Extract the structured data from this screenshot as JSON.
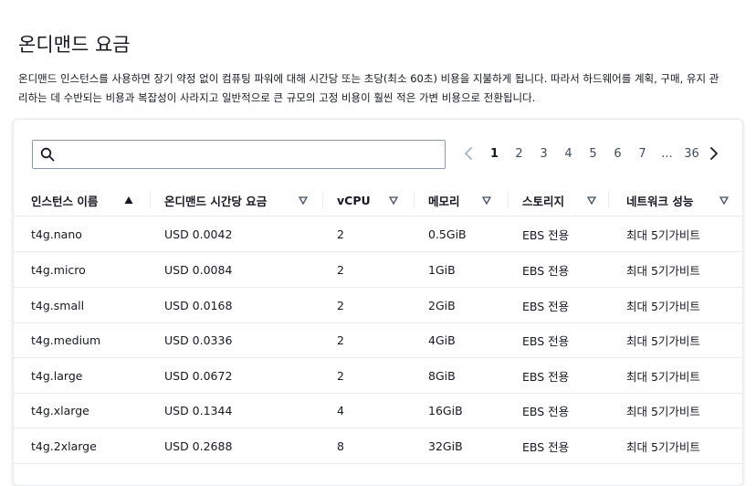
{
  "page": {
    "title": "온디맨드 요금",
    "description_line1": "온디맨드 인스턴스를 사용하면 장기 약정 없이 컴퓨팅 파워에 대해 시간당 또는 초당(최소 60초) 비용을 지불하게 됩니다. 따라서 하드웨어를 계획, 구매, 유지 관",
    "description_line2": "리하는 데 수반되는 비용과 복잡성이 사라지고 일반적으로 큰 규모의 고정 비용이 훨씬 적은 가변 비용으로 전환됩니다."
  },
  "search": {
    "value": "",
    "placeholder": ""
  },
  "pagination": {
    "pages": [
      "1",
      "2",
      "3",
      "4",
      "5",
      "6",
      "7"
    ],
    "current": "1",
    "ellipsis": "...",
    "last": "36",
    "prev_icon": "chevron-left-icon",
    "next_icon": "chevron-right-icon"
  },
  "table": {
    "columns": [
      {
        "label": "인스턴스 이름",
        "sort": "ascending"
      },
      {
        "label": "온디맨드 시간당 요금",
        "sort": "none"
      },
      {
        "label": "vCPU",
        "sort": "none"
      },
      {
        "label": "메모리",
        "sort": "none"
      },
      {
        "label": "스토리지",
        "sort": "none"
      },
      {
        "label": "네트워크 성능",
        "sort": "none"
      }
    ],
    "rows": [
      {
        "name": "t4g.nano",
        "price": "USD 0.0042",
        "vcpu": "2",
        "memory": "0.5GiB",
        "storage": "EBS 전용",
        "network": "최대 5기가비트"
      },
      {
        "name": "t4g.micro",
        "price": "USD 0.0084",
        "vcpu": "2",
        "memory": "1GiB",
        "storage": "EBS 전용",
        "network": "최대 5기가비트"
      },
      {
        "name": "t4g.small",
        "price": "USD 0.0168",
        "vcpu": "2",
        "memory": "2GiB",
        "storage": "EBS 전용",
        "network": "최대 5기가비트"
      },
      {
        "name": "t4g.medium",
        "price": "USD 0.0336",
        "vcpu": "2",
        "memory": "4GiB",
        "storage": "EBS 전용",
        "network": "최대 5기가비트"
      },
      {
        "name": "t4g.large",
        "price": "USD 0.0672",
        "vcpu": "2",
        "memory": "8GiB",
        "storage": "EBS 전용",
        "network": "최대 5기가비트"
      },
      {
        "name": "t4g.xlarge",
        "price": "USD 0.1344",
        "vcpu": "4",
        "memory": "16GiB",
        "storage": "EBS 전용",
        "network": "최대 5기가비트"
      },
      {
        "name": "t4g.2xlarge",
        "price": "USD 0.2688",
        "vcpu": "8",
        "memory": "32GiB",
        "storage": "EBS 전용",
        "network": "최대 5기가비트"
      }
    ]
  },
  "colors": {
    "text": "#16191f",
    "border": "#e9ebed",
    "input_border": "#8d99a8",
    "muted": "#414d5c"
  }
}
